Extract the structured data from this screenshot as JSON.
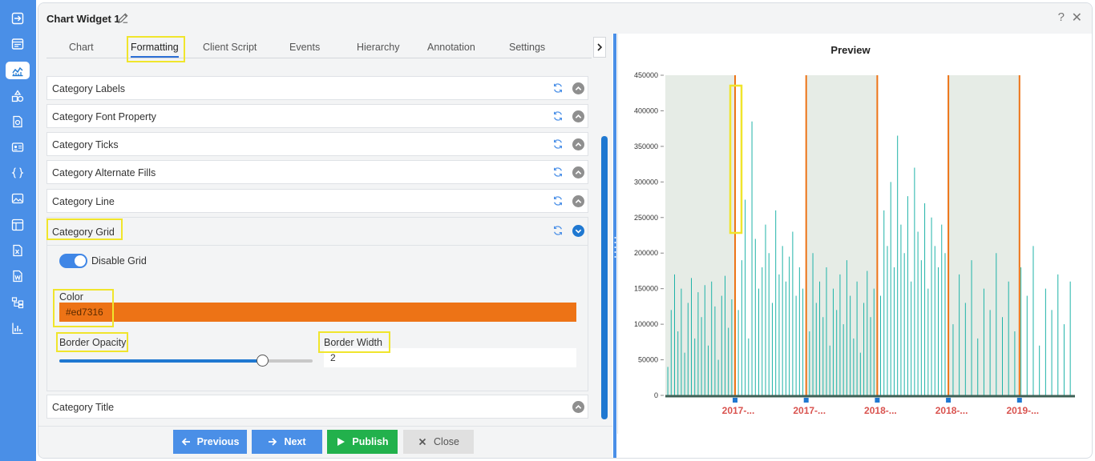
{
  "window": {
    "title": "Chart Widget 1",
    "help": "?",
    "close": "✕"
  },
  "tabs": [
    {
      "label": "Chart"
    },
    {
      "label": "Formatting"
    },
    {
      "label": "Client Script"
    },
    {
      "label": "Events"
    },
    {
      "label": "Hierarchy"
    },
    {
      "label": "Annotation"
    },
    {
      "label": "Settings"
    }
  ],
  "active_tab": "Formatting",
  "sections": [
    {
      "label": "Category Labels"
    },
    {
      "label": "Category Font Property"
    },
    {
      "label": "Category Ticks"
    },
    {
      "label": "Category Alternate Fills"
    },
    {
      "label": "Category Line"
    },
    {
      "label": "Category Grid"
    },
    {
      "label": "Category Title"
    }
  ],
  "grid_settings": {
    "toggle_label": "Disable Grid",
    "toggle_on": true,
    "color_label": "Color",
    "color_value": "#ed7316",
    "opacity_label": "Border Opacity",
    "opacity_fraction": 0.8,
    "width_label": "Border Width",
    "width_value": "2"
  },
  "footer": {
    "previous": "Previous",
    "next": "Next",
    "publish": "Publish",
    "close": "Close"
  },
  "preview": {
    "title": "Preview"
  },
  "colors": {
    "rail": "#4a8fe7",
    "accent": "#1f78d1",
    "grid_line": "#ed7316",
    "bar": "#1fb3a8",
    "alt_fill": "#e6ece6",
    "category_label": "#d9534f",
    "publish": "#22b14c",
    "button_blue": "#4a8fe7",
    "button_gray": "#e0e0e0"
  },
  "chart_data": {
    "type": "bar",
    "y_ticks": [
      "450000",
      "400000",
      "350000",
      "300000",
      "250000",
      "200000",
      "150000",
      "100000",
      "50000",
      "0"
    ],
    "ylim": [
      0,
      450000
    ],
    "x_tick_labels": [
      "2017-...",
      "2017-...",
      "2018-...",
      "2018-...",
      "2019-..."
    ],
    "category_grid": true,
    "alternate_fills": true,
    "bar_groups": [
      {
        "peak": 170000,
        "values": [
          40000,
          120000,
          170000,
          90000,
          150000,
          60000,
          130000,
          165000,
          80000,
          145000,
          110000,
          155000,
          70000,
          160000,
          125000,
          50000,
          140000,
          168000,
          95000,
          135000
        ]
      },
      {
        "peak": 385000,
        "values": [
          120000,
          190000,
          275000,
          80000,
          385000,
          220000,
          150000,
          180000,
          240000,
          200000,
          130000,
          260000,
          170000,
          210000,
          160000,
          195000,
          230000,
          140000,
          180000,
          150000
        ]
      },
      {
        "peak": 200000,
        "values": [
          90000,
          200000,
          130000,
          160000,
          110000,
          180000,
          70000,
          150000,
          120000,
          170000,
          100000,
          190000,
          140000,
          80000,
          160000,
          60000,
          130000,
          175000,
          110000,
          150000
        ]
      },
      {
        "peak": 365000,
        "values": [
          140000,
          260000,
          210000,
          300000,
          180000,
          365000,
          240000,
          200000,
          280000,
          160000,
          320000,
          230000,
          190000,
          270000,
          150000,
          250000,
          210000,
          180000,
          240000,
          200000
        ]
      },
      {
        "peak": 210000,
        "values": [
          100000,
          170000,
          130000,
          190000,
          80000,
          150000,
          120000,
          200000,
          110000,
          160000,
          90000,
          180000,
          140000,
          210000,
          70000,
          150000,
          120000,
          170000,
          100000,
          160000
        ]
      }
    ]
  }
}
